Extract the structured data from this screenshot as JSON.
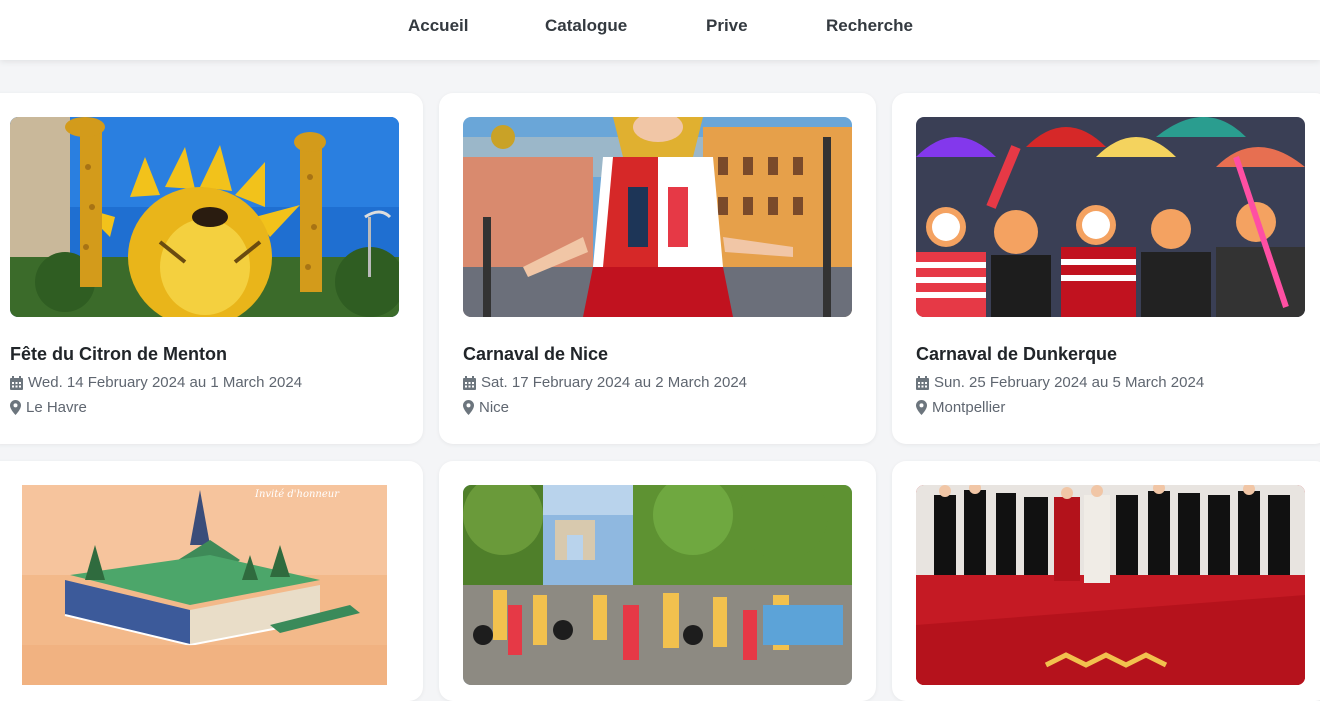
{
  "nav": {
    "items": [
      "Accueil",
      "Catalogue",
      "Prive",
      "Recherche"
    ]
  },
  "events": [
    {
      "title": "Fête du Citron de Menton",
      "date": "Wed. 14 February 2024 au 1 March 2024",
      "location": "Le Havre",
      "image": "lemon-lion-giraffe-sculpture"
    },
    {
      "title": "Carnaval de Nice",
      "date": "Sat. 17 February 2024 au 2 March 2024",
      "location": "Nice",
      "image": "carnival-jester-float"
    },
    {
      "title": "Carnaval de Dunkerque",
      "date": "Sun. 25 February 2024 au 5 March 2024",
      "location": "Montpellier",
      "image": "costumed-crowd-umbrellas"
    },
    {
      "image": "book-eiffel-tower-poster",
      "poster_text": "Invité d'honneur"
    },
    {
      "image": "champs-elysees-parade"
    },
    {
      "image": "red-carpet-group"
    }
  ],
  "icons": {
    "date": "calendar-icon",
    "location": "map-marker-icon"
  },
  "colors": {
    "page_bg": "#f4f5f7",
    "card_bg": "#ffffff",
    "title": "#212529",
    "meta": "#5f6670"
  }
}
